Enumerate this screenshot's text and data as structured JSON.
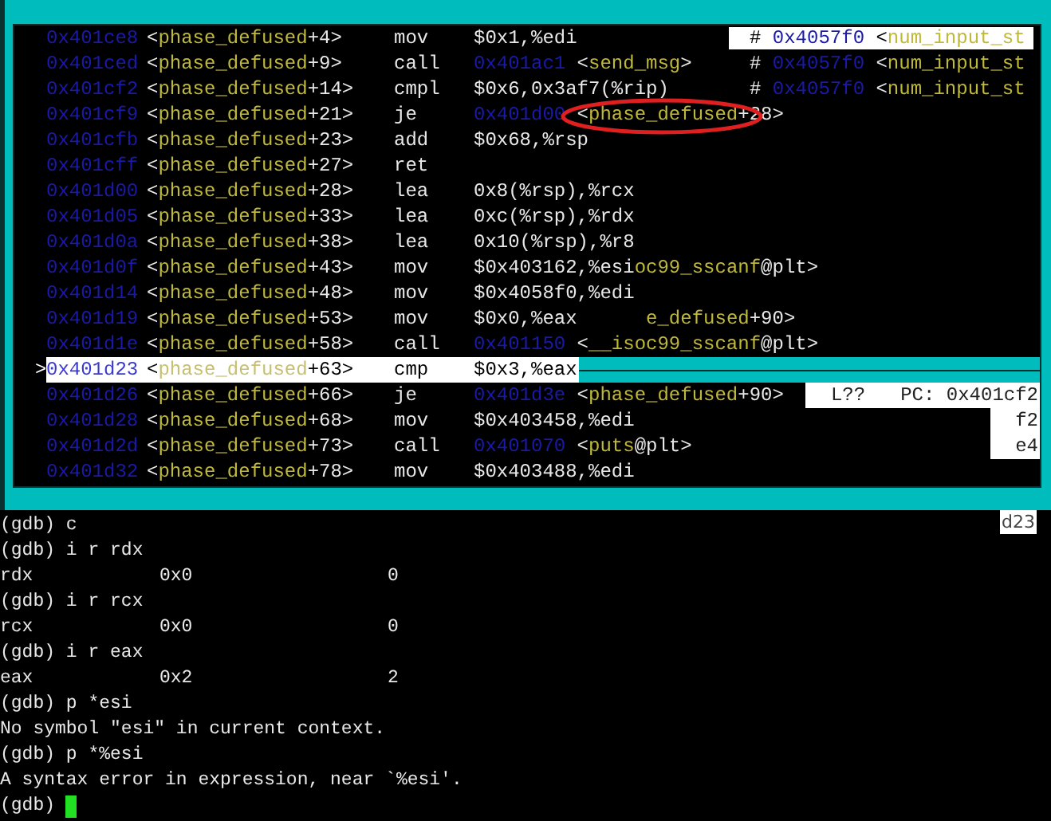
{
  "disassembly": [
    {
      "address": "0x401ce8",
      "symbol": [
        "<",
        "phase_defused",
        "+4>"
      ],
      "mnemonic": "mov",
      "operand": [
        {
          "kind": "plain",
          "text": "$0x1,%edi"
        }
      ],
      "comment": [
        {
          "kind": "plain",
          "text": "# "
        },
        {
          "kind": "address",
          "text": "0x4057f0"
        },
        {
          "kind": "plain",
          "text": " <"
        },
        {
          "kind": "name",
          "text": "num_input_st"
        }
      ],
      "comment_highlighted": true,
      "selected": false,
      "circled": false
    },
    {
      "address": "0x401ced",
      "symbol": [
        "<",
        "phase_defused",
        "+9>"
      ],
      "mnemonic": "call",
      "operand": [
        {
          "kind": "address",
          "text": "0x401ac1"
        },
        {
          "kind": "plain",
          "text": " <"
        },
        {
          "kind": "name",
          "text": "send_msg"
        },
        {
          "kind": "plain",
          "text": ">"
        }
      ],
      "comment": [
        {
          "kind": "plain",
          "text": "# "
        },
        {
          "kind": "address",
          "text": "0x4057f0"
        },
        {
          "kind": "plain",
          "text": " <"
        },
        {
          "kind": "name",
          "text": "num_input_st"
        }
      ],
      "comment_highlighted": false,
      "selected": false,
      "circled": false
    },
    {
      "address": "0x401cf2",
      "symbol": [
        "<",
        "phase_defused",
        "+14>"
      ],
      "mnemonic": "cmpl",
      "operand": [
        {
          "kind": "plain",
          "text": "$0x6,0x3af7(%rip)"
        }
      ],
      "comment": [
        {
          "kind": "plain",
          "text": "# "
        },
        {
          "kind": "address",
          "text": "0x4057f0"
        },
        {
          "kind": "plain",
          "text": " <"
        },
        {
          "kind": "name",
          "text": "num_input_st"
        }
      ],
      "comment_highlighted": false,
      "selected": false,
      "circled": false
    },
    {
      "address": "0x401cf9",
      "symbol": [
        "<",
        "phase_defused",
        "+21>"
      ],
      "mnemonic": "je",
      "operand": [
        {
          "kind": "address",
          "text": "0x401d00"
        },
        {
          "kind": "plain",
          "text": " <"
        },
        {
          "kind": "name",
          "text": "phase_defused"
        },
        {
          "kind": "plain",
          "text": "+28>"
        }
      ],
      "selected": false,
      "circled": true
    },
    {
      "address": "0x401cfb",
      "symbol": [
        "<",
        "phase_defused",
        "+23>"
      ],
      "mnemonic": "add",
      "operand": [
        {
          "kind": "plain",
          "text": "$0x68,%rsp"
        }
      ],
      "selected": false,
      "circled": false
    },
    {
      "address": "0x401cff",
      "symbol": [
        "<",
        "phase_defused",
        "+27>"
      ],
      "mnemonic": "ret",
      "selected": false,
      "circled": false
    },
    {
      "address": "0x401d00",
      "symbol": [
        "<",
        "phase_defused",
        "+28>"
      ],
      "mnemonic": "lea",
      "operand": [
        {
          "kind": "plain",
          "text": "0x8(%rsp),%rcx"
        }
      ],
      "selected": false,
      "circled": false
    },
    {
      "address": "0x401d05",
      "symbol": [
        "<",
        "phase_defused",
        "+33>"
      ],
      "mnemonic": "lea",
      "operand": [
        {
          "kind": "plain",
          "text": "0xc(%rsp),%rdx"
        }
      ],
      "selected": false,
      "circled": false
    },
    {
      "address": "0x401d0a",
      "symbol": [
        "<",
        "phase_defused",
        "+38>"
      ],
      "mnemonic": "lea",
      "operand": [
        {
          "kind": "plain",
          "text": "0x10(%rsp),%r8"
        }
      ],
      "selected": false,
      "circled": false
    },
    {
      "address": "0x401d0f",
      "symbol": [
        "<",
        "phase_defused",
        "+43>"
      ],
      "mnemonic": "mov",
      "operand": [
        {
          "kind": "plain",
          "text": "$0x403162,%esi"
        },
        {
          "kind": "name",
          "text": "oc99_sscanf"
        },
        {
          "kind": "plain",
          "text": "@plt>"
        }
      ],
      "selected": false,
      "circled": false
    },
    {
      "address": "0x401d14",
      "symbol": [
        "<",
        "phase_defused",
        "+48>"
      ],
      "mnemonic": "mov",
      "operand": [
        {
          "kind": "plain",
          "text": "$0x4058f0,%edi"
        }
      ],
      "selected": false,
      "circled": false
    },
    {
      "address": "0x401d19",
      "symbol": [
        "<",
        "phase_defused",
        "+53>"
      ],
      "mnemonic": "mov",
      "operand": [
        {
          "kind": "plain",
          "text": "$0x0,%eax      "
        },
        {
          "kind": "name",
          "text": "e_defused"
        },
        {
          "kind": "plain",
          "text": "+90>"
        }
      ],
      "selected": false,
      "circled": false
    },
    {
      "address": "0x401d1e",
      "symbol": [
        "<",
        "phase_defused",
        "+58>"
      ],
      "mnemonic": "call",
      "operand": [
        {
          "kind": "address",
          "text": "0x401150"
        },
        {
          "kind": "plain",
          "text": " <"
        },
        {
          "kind": "name",
          "text": "__isoc99_sscanf"
        },
        {
          "kind": "plain",
          "text": "@plt>"
        }
      ],
      "selected": false,
      "circled": false
    },
    {
      "marker": ">",
      "address": "0x401d23",
      "symbol": [
        "<",
        "phase_defused",
        "+63>"
      ],
      "mnemonic": "cmp",
      "operand": [
        {
          "kind": "plain",
          "text": "$0x3,%eax"
        }
      ],
      "selected": true,
      "circled": false
    },
    {
      "address": "0x401d26",
      "symbol": [
        "<",
        "phase_defused",
        "+66>"
      ],
      "mnemonic": "je",
      "operand": [
        {
          "kind": "address",
          "text": "0x401d3e"
        },
        {
          "kind": "plain",
          "text": " <"
        },
        {
          "kind": "name",
          "text": "phase_defused"
        },
        {
          "kind": "plain",
          "text": "+90>"
        }
      ],
      "status": [
        "L??",
        "PC: 0x401cf2"
      ],
      "selected": false,
      "circled": false
    },
    {
      "address": "0x401d28",
      "symbol": [
        "<",
        "phase_defused",
        "+68>"
      ],
      "mnemonic": "mov",
      "operand": [
        {
          "kind": "plain",
          "text": "$0x403458,%edi"
        }
      ],
      "status": [
        "f2"
      ],
      "selected": false,
      "circled": false
    },
    {
      "address": "0x401d2d",
      "symbol": [
        "<",
        "phase_defused",
        "+73>"
      ],
      "mnemonic": "call",
      "operand": [
        {
          "kind": "address",
          "text": "0x401070"
        },
        {
          "kind": "plain",
          "text": " <"
        },
        {
          "kind": "name",
          "text": "puts"
        },
        {
          "kind": "plain",
          "text": "@plt>"
        }
      ],
      "status": [
        "e4"
      ],
      "selected": false,
      "circled": false
    },
    {
      "address": "0x401d32",
      "symbol": [
        "<",
        "phase_defused",
        "+78>"
      ],
      "mnemonic": "mov",
      "operand": [
        {
          "kind": "plain",
          "text": "$0x403488,%edi"
        }
      ],
      "selected": false,
      "circled": false
    }
  ],
  "corner_fragment": "d23",
  "console": [
    {
      "kind": "text",
      "text": "(gdb) c"
    },
    {
      "kind": "text",
      "text": "(gdb) i r rdx"
    },
    {
      "kind": "register",
      "cells": [
        "rdx",
        "0x0",
        "0"
      ]
    },
    {
      "kind": "text",
      "text": "(gdb) i r rcx"
    },
    {
      "kind": "register",
      "cells": [
        "rcx",
        "0x0",
        "0"
      ]
    },
    {
      "kind": "text",
      "text": "(gdb) i r eax"
    },
    {
      "kind": "register",
      "cells": [
        "eax",
        "0x2",
        "2"
      ]
    },
    {
      "kind": "text",
      "text": "(gdb) p *esi"
    },
    {
      "kind": "text",
      "text": "No symbol \"esi\" in current context."
    },
    {
      "kind": "text",
      "text": "(gdb) p *%esi"
    },
    {
      "kind": "text",
      "text": "A syntax error in expression, near `%esi'."
    },
    {
      "kind": "text",
      "text": "(gdb) ",
      "cursor": true
    }
  ]
}
